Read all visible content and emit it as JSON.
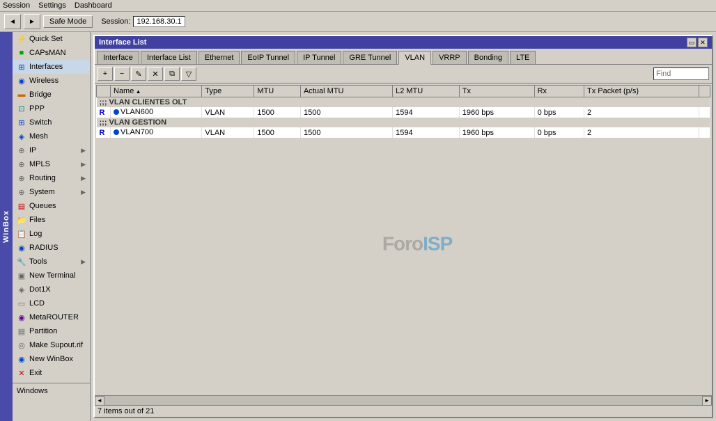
{
  "menu": {
    "items": [
      "Session",
      "Settings",
      "Dashboard"
    ]
  },
  "toolbar": {
    "back_label": "◄",
    "forward_label": "►",
    "safe_mode_label": "Safe Mode",
    "session_label": "Session:",
    "session_ip": "192.168.30.1"
  },
  "sidebar": {
    "winbox_label": "WinBox",
    "items": [
      {
        "id": "quick-set",
        "label": "Quick Set",
        "icon": "⚡",
        "color": "icon-orange",
        "has_arrow": false
      },
      {
        "id": "capsman",
        "label": "CAPsMAN",
        "icon": "●",
        "color": "icon-green",
        "has_arrow": false
      },
      {
        "id": "interfaces",
        "label": "Interfaces",
        "icon": "⊞",
        "color": "icon-blue",
        "has_arrow": false,
        "active": true
      },
      {
        "id": "wireless",
        "label": "Wireless",
        "icon": "((·))",
        "color": "icon-blue",
        "has_arrow": false
      },
      {
        "id": "bridge",
        "label": "Bridge",
        "icon": "▬",
        "color": "icon-orange",
        "has_arrow": false
      },
      {
        "id": "ppp",
        "label": "PPP",
        "icon": "⊡",
        "color": "icon-teal",
        "has_arrow": false
      },
      {
        "id": "switch",
        "label": "Switch",
        "icon": "⊞",
        "color": "icon-blue",
        "has_arrow": false
      },
      {
        "id": "mesh",
        "label": "Mesh",
        "icon": "◈",
        "color": "icon-blue",
        "has_arrow": false
      },
      {
        "id": "ip",
        "label": "IP",
        "icon": "⊕",
        "color": "icon-gray",
        "has_arrow": true
      },
      {
        "id": "mpls",
        "label": "MPLS",
        "icon": "⊕",
        "color": "icon-gray",
        "has_arrow": true
      },
      {
        "id": "routing",
        "label": "Routing",
        "icon": "⊕",
        "color": "icon-gray",
        "has_arrow": true
      },
      {
        "id": "system",
        "label": "System",
        "icon": "⊕",
        "color": "icon-gray",
        "has_arrow": true
      },
      {
        "id": "queues",
        "label": "Queues",
        "icon": "▤",
        "color": "icon-red",
        "has_arrow": false
      },
      {
        "id": "files",
        "label": "Files",
        "icon": "📁",
        "color": "icon-gray",
        "has_arrow": false
      },
      {
        "id": "log",
        "label": "Log",
        "icon": "📋",
        "color": "icon-gray",
        "has_arrow": false
      },
      {
        "id": "radius",
        "label": "RADIUS",
        "icon": "◉",
        "color": "icon-blue",
        "has_arrow": false
      },
      {
        "id": "tools",
        "label": "Tools",
        "icon": "🔧",
        "color": "icon-orange",
        "has_arrow": true
      },
      {
        "id": "new-terminal",
        "label": "New Terminal",
        "icon": "▣",
        "color": "icon-gray",
        "has_arrow": false
      },
      {
        "id": "dot1x",
        "label": "Dot1X",
        "icon": "◈",
        "color": "icon-gray",
        "has_arrow": false
      },
      {
        "id": "lcd",
        "label": "LCD",
        "icon": "▭",
        "color": "icon-gray",
        "has_arrow": false
      },
      {
        "id": "metarouter",
        "label": "MetaROUTER",
        "icon": "◉",
        "color": "icon-purple",
        "has_arrow": false
      },
      {
        "id": "partition",
        "label": "Partition",
        "icon": "▤",
        "color": "icon-gray",
        "has_arrow": false
      },
      {
        "id": "make-supout",
        "label": "Make Supout.rif",
        "icon": "◎",
        "color": "icon-gray",
        "has_arrow": false
      },
      {
        "id": "new-winbox",
        "label": "New WinBox",
        "icon": "◉",
        "color": "icon-blue",
        "has_arrow": false
      },
      {
        "id": "exit",
        "label": "Exit",
        "icon": "✕",
        "color": "icon-red",
        "has_arrow": false
      }
    ],
    "windows_label": "Windows"
  },
  "window": {
    "title": "Interface List",
    "tabs": [
      {
        "id": "interface",
        "label": "Interface",
        "active": false
      },
      {
        "id": "interface-list",
        "label": "Interface List",
        "active": false
      },
      {
        "id": "ethernet",
        "label": "Ethernet",
        "active": false
      },
      {
        "id": "eoip-tunnel",
        "label": "EoIP Tunnel",
        "active": false
      },
      {
        "id": "ip-tunnel",
        "label": "IP Tunnel",
        "active": false
      },
      {
        "id": "gre-tunnel",
        "label": "GRE Tunnel",
        "active": false
      },
      {
        "id": "vlan",
        "label": "VLAN",
        "active": true
      },
      {
        "id": "vrrp",
        "label": "VRRP",
        "active": false
      },
      {
        "id": "bonding",
        "label": "Bonding",
        "active": false
      },
      {
        "id": "lte",
        "label": "LTE",
        "active": false
      }
    ],
    "toolbar": {
      "add": "+",
      "remove": "−",
      "edit": "✎",
      "delete": "✕",
      "copy": "⧉",
      "filter": "▽",
      "find_placeholder": "Find"
    },
    "table": {
      "columns": [
        "",
        "Name",
        "Type",
        "MTU",
        "Actual MTU",
        "L2 MTU",
        "Tx",
        "Rx",
        "Tx Packet (p/s)",
        ""
      ],
      "sections": [
        {
          "header": ";;; VLAN CLIENTES OLT",
          "rows": [
            {
              "flag": "R",
              "icon": "vlan",
              "name": "VLAN600",
              "type": "VLAN",
              "mtu": "1500",
              "actual_mtu": "1500",
              "l2_mtu": "1594",
              "tx": "1960 bps",
              "rx": "0 bps",
              "tx_packet": "2"
            }
          ]
        },
        {
          "header": ";;; VLAN GESTION",
          "rows": [
            {
              "flag": "R",
              "icon": "vlan",
              "name": "VLAN700",
              "type": "VLAN",
              "mtu": "1500",
              "actual_mtu": "1500",
              "l2_mtu": "1594",
              "tx": "1960 bps",
              "rx": "0 bps",
              "tx_packet": "2"
            }
          ]
        }
      ]
    },
    "watermark": "ForoISP",
    "status": "7 items out of 21"
  },
  "colors": {
    "title_bar_bg": "#4040a0",
    "sidebar_active": "#4a4aaa",
    "tab_active_bg": "#d4d0c8",
    "accent_blue": "#0044cc"
  }
}
